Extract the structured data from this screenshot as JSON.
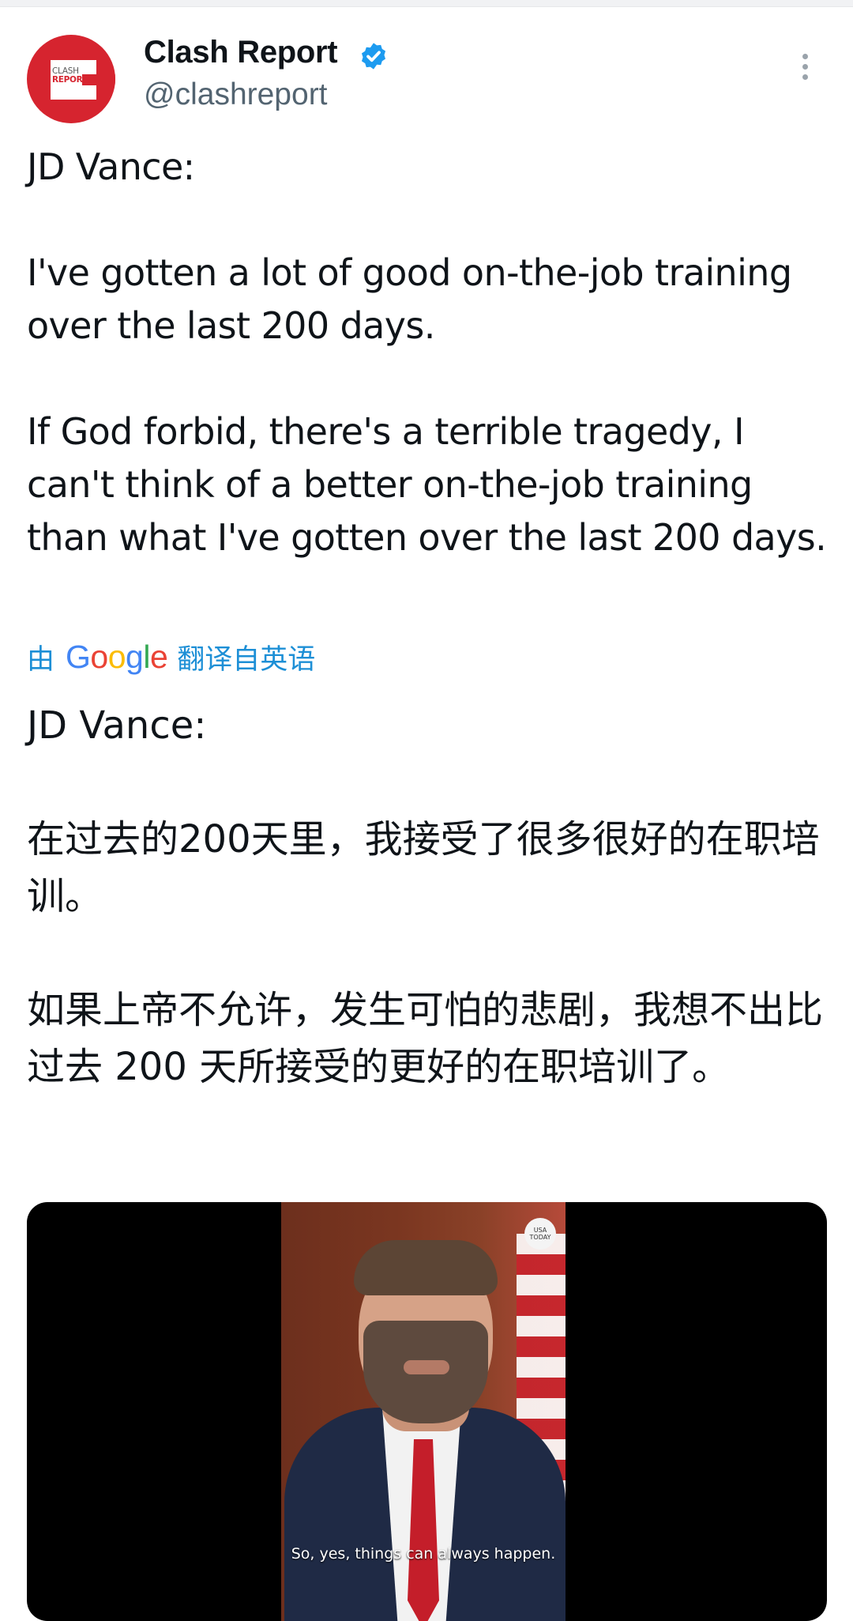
{
  "author": {
    "display_name": "Clash Report",
    "handle": "@clashreport",
    "verified": true,
    "avatar_text_line1": "CLASH",
    "avatar_text_line2": "REPORT",
    "brand_color": "#d6242f"
  },
  "post": {
    "original_text": "JD Vance:\n\nI've gotten a lot of good on-the-job training over the last 200 days.\n\nIf God forbid, there's a terrible tragedy, I can't think of a better on-the-job training than what I've gotten over the last 200 days.",
    "translation": {
      "prefix": "由",
      "provider": "Google",
      "suffix": "翻译自英语",
      "text": "JD Vance:\n\n在过去的200天里，我接受了很多很好的在职培训。\n\n如果上帝不允许，发生可怕的悲剧，我想不出比过去 200 天所接受的更好的在职培训了。"
    }
  },
  "video": {
    "watermark": "USA TODAY",
    "subtitle": "So, yes, things can always happen."
  },
  "icons": [
    "more-options-icon",
    "verified-badge-icon"
  ],
  "colors": {
    "link_blue": "#1d8fd6",
    "verified_blue": "#1d9bf0",
    "secondary_text": "#536471"
  }
}
